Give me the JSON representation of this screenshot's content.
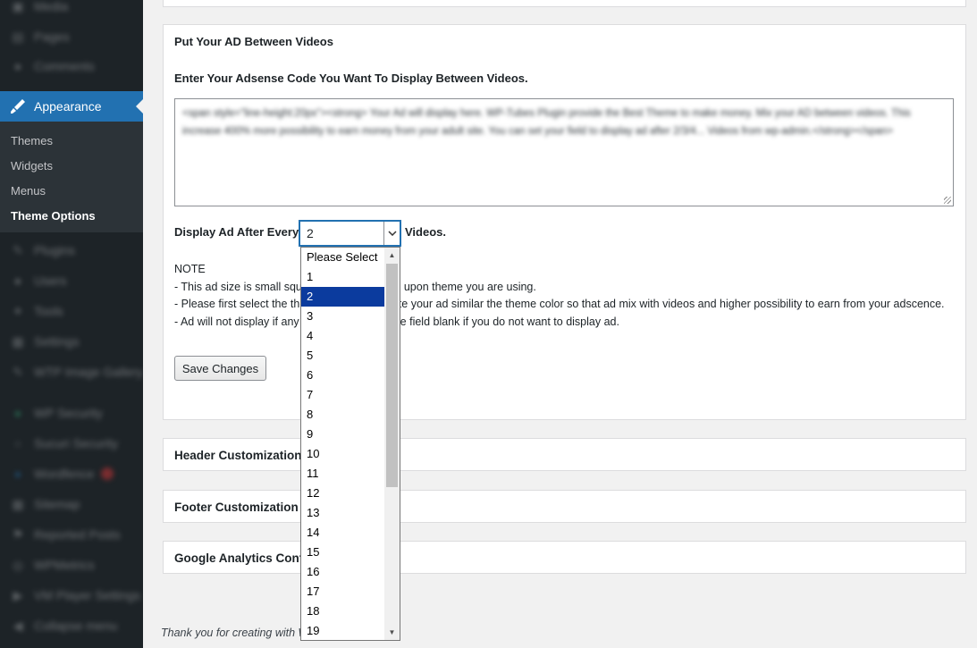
{
  "sidebar": {
    "top_items": [
      {
        "label": "Media",
        "icon": "media-icon"
      },
      {
        "label": "Pages",
        "icon": "pages-icon"
      },
      {
        "label": "Comments",
        "icon": "comments-icon"
      }
    ],
    "active": {
      "label": "Appearance",
      "icon": "brush-icon"
    },
    "submenu": [
      "Themes",
      "Widgets",
      "Menus",
      "Theme Options"
    ],
    "bottom_items": [
      {
        "label": "Plugins",
        "icon": "plugins-icon"
      },
      {
        "label": "Users",
        "icon": "users-icon"
      },
      {
        "label": "Tools",
        "icon": "tools-icon"
      },
      {
        "label": "Settings",
        "icon": "settings-icon"
      },
      {
        "label": "WTP Image Gallery",
        "icon": "gallery-icon"
      },
      {
        "label": "WP Security",
        "icon": "security-icon"
      },
      {
        "label": "Sucuri Security",
        "icon": "shield-icon"
      },
      {
        "label": "Wordfence",
        "icon": "wordfence-icon"
      },
      {
        "label": "Sitemap",
        "icon": "sitemap-icon"
      },
      {
        "label": "Reported Posts",
        "icon": "flag-icon"
      },
      {
        "label": "WPMetrics",
        "icon": "metrics-icon"
      },
      {
        "label": "VM Player Settings",
        "icon": "player-icon"
      },
      {
        "label": "Collapse menu",
        "icon": "collapse-icon"
      }
    ]
  },
  "section": {
    "title": "Put Your AD Between Videos",
    "subtitle": "Enter Your Adsense Code You Want To Display Between Videos.",
    "code_value": "<span style=\"line-height:20px\"><strong> Your Ad will display here. WP-Tubes Plugin provide the Best Theme to make money. Mix your AD between videos. This increase 400% more possibility to earn money from your adult site. You can set your field to display ad after 2/3/4... Videos from wp-admin.</strong></span>",
    "display_label": "Display Ad After Every",
    "display_after": "Videos.",
    "selected_value": "2"
  },
  "note": {
    "title": "NOTE",
    "lines": [
      "- This ad size is small square. Ad size depend upon theme you are using.",
      "- Please first select the theme color then create your ad similar the theme color so that ad mix with videos and higher possibility to earn from your adscence.",
      "- Ad will not display if any field empty. Keep the field blank if you do not want to display ad."
    ]
  },
  "save_button": "Save Changes",
  "panels": {
    "header": "Header Customization",
    "footer": "Footer Customization",
    "analytics": "Google Analytics Configuration"
  },
  "footer_thanks": "Thank you for creating with WordPress.",
  "dropdown": {
    "options": [
      "Please Select",
      "1",
      "2",
      "3",
      "4",
      "5",
      "6",
      "7",
      "8",
      "9",
      "10",
      "11",
      "12",
      "13",
      "14",
      "15",
      "16",
      "17",
      "18",
      "19"
    ],
    "selected_index": 2
  }
}
